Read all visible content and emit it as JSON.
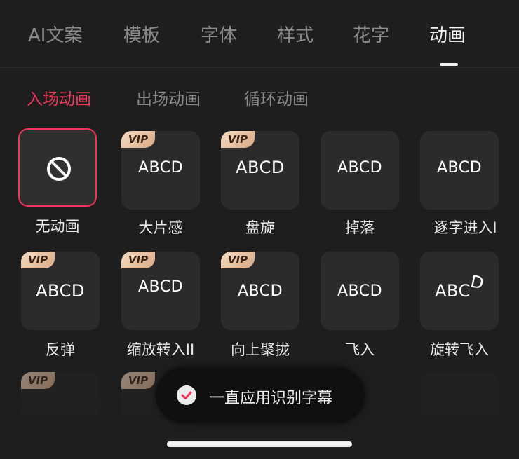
{
  "tabs": [
    {
      "label": "AI文案"
    },
    {
      "label": "模板"
    },
    {
      "label": "字体"
    },
    {
      "label": "样式"
    },
    {
      "label": "花字"
    },
    {
      "label": "动画",
      "active": true
    }
  ],
  "subtabs": [
    {
      "label": "入场动画",
      "active": true
    },
    {
      "label": "出场动画"
    },
    {
      "label": "循环动画"
    }
  ],
  "sample_text": "ABCD",
  "vip_badge": "VIP",
  "animations_row1": [
    {
      "label": "无动画",
      "selected": true,
      "icon": "no-entry-icon"
    },
    {
      "label": "大片感",
      "vip": true
    },
    {
      "label": "盘旋",
      "vip": true
    },
    {
      "label": "掉落"
    },
    {
      "label": "逐字进入I"
    }
  ],
  "animations_row2": [
    {
      "label": "反弹",
      "vip": true
    },
    {
      "label": "缩放转入II",
      "vip": true
    },
    {
      "label": "向上聚拢",
      "vip": true
    },
    {
      "label": "飞入"
    },
    {
      "label": "旋转飞入"
    }
  ],
  "toast": {
    "text": "一直应用识别字幕",
    "icon": "checkmark-icon"
  },
  "colors": {
    "accent": "#f0355a",
    "background": "#1e1e1e",
    "tile": "#2b2b2b",
    "vip_gold": "#e8c2a0"
  }
}
